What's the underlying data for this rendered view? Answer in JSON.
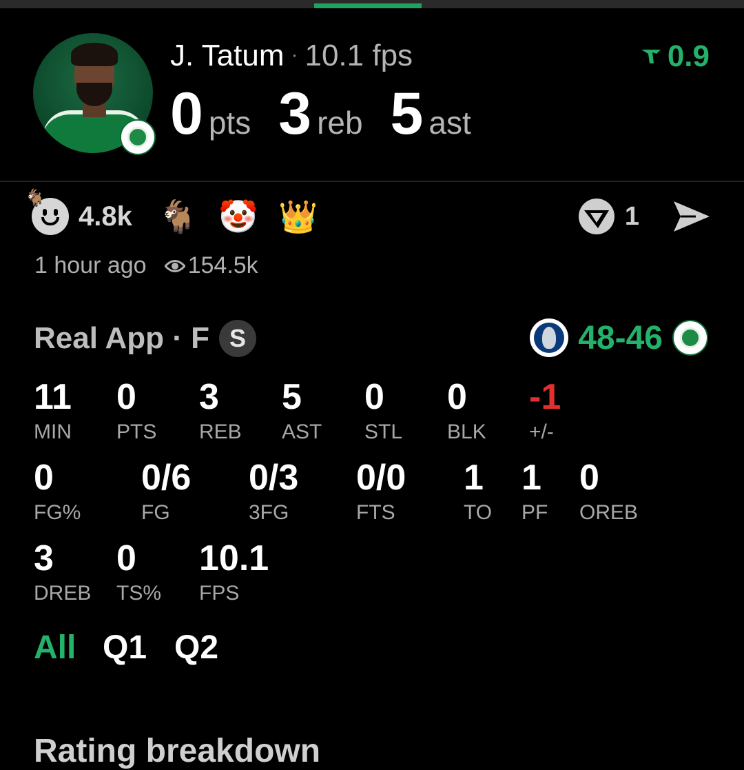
{
  "player": {
    "name": "J. Tatum",
    "separator": "·",
    "fps_label": "10.1 fps",
    "score_badge": "0.9",
    "headline": [
      {
        "value": "0",
        "unit": "pts"
      },
      {
        "value": "3",
        "unit": "reb"
      },
      {
        "value": "5",
        "unit": "ast"
      }
    ]
  },
  "reactions": {
    "count": "4.8k",
    "emojis": [
      "goat",
      "clown",
      "crown"
    ],
    "ring_count": "1"
  },
  "meta": {
    "time_ago": "1 hour ago",
    "views": "154.5k"
  },
  "game": {
    "label": "Real App · F",
    "badge": "S",
    "score": "48-46"
  },
  "stats": {
    "row1": [
      {
        "value": "11",
        "label": "MIN"
      },
      {
        "value": "0",
        "label": "PTS"
      },
      {
        "value": "3",
        "label": "REB"
      },
      {
        "value": "5",
        "label": "AST"
      },
      {
        "value": "0",
        "label": "STL"
      },
      {
        "value": "0",
        "label": "BLK"
      },
      {
        "value": "-1",
        "label": "+/-"
      }
    ],
    "row2": [
      {
        "value": "0",
        "label": "FG%"
      },
      {
        "value": "0/6",
        "label": "FG"
      },
      {
        "value": "0/3",
        "label": "3FG"
      },
      {
        "value": "0/0",
        "label": "FTS"
      },
      {
        "value": "1",
        "label": "TO"
      },
      {
        "value": "1",
        "label": "PF"
      },
      {
        "value": "0",
        "label": "OREB"
      }
    ],
    "row3": [
      {
        "value": "3",
        "label": "DREB"
      },
      {
        "value": "0",
        "label": "TS%"
      },
      {
        "value": "10.1",
        "label": "FPS"
      }
    ]
  },
  "periods": [
    "All",
    "Q1",
    "Q2"
  ],
  "next_section_title": "Rating breakdown",
  "colors": {
    "accent": "#24b26a",
    "negative": "#e23030",
    "background": "#000000"
  }
}
